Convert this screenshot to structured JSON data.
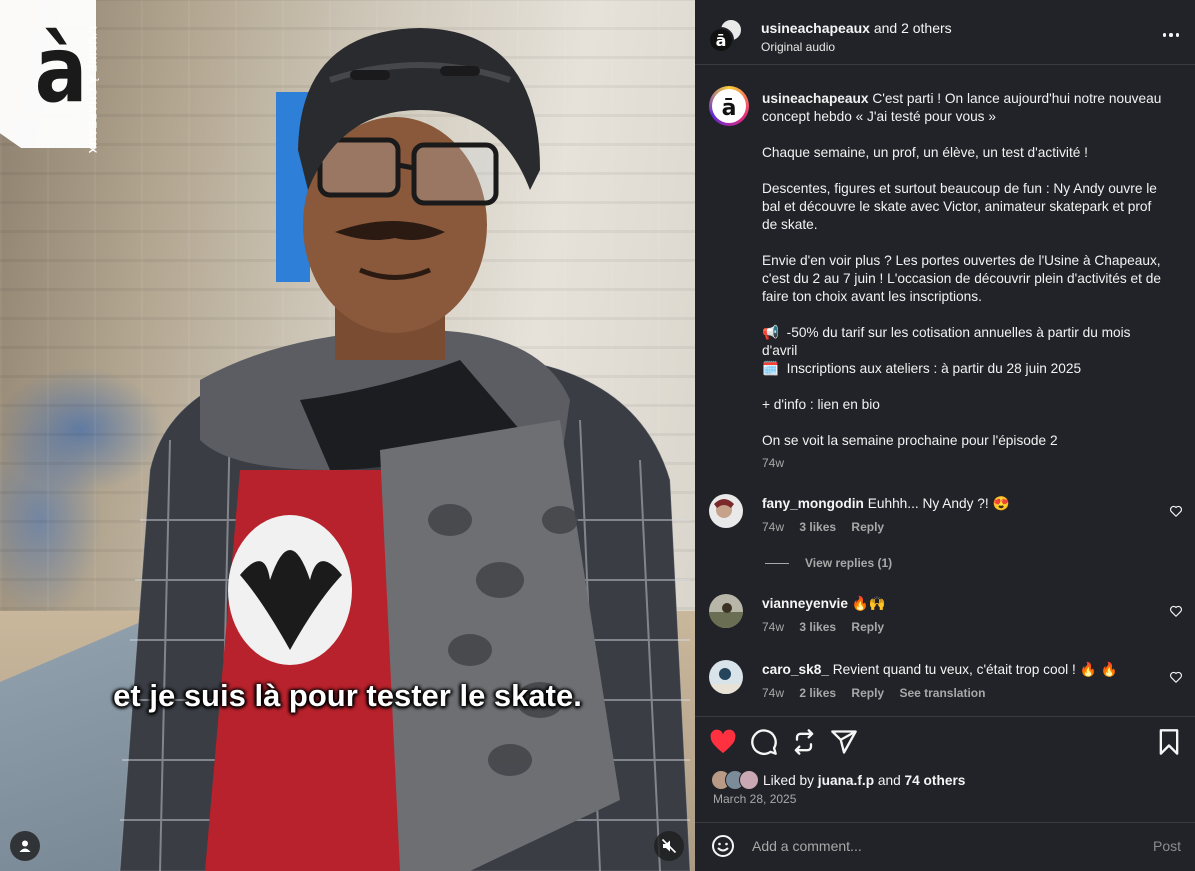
{
  "media": {
    "logo_glyph": "à",
    "logo_side_text": "L'USINE À CHAPEAUX",
    "subtitle": "et je suis là pour tester le skate."
  },
  "header": {
    "username": "usineachapeaux",
    "others": " and 2 others",
    "audio": "Original audio"
  },
  "caption": {
    "username": "usineachapeaux",
    "text": " C'est parti ! On lance aujourd'hui notre nouveau concept hebdo « J'ai testé pour vous »\n\nChaque semaine, un prof, un élève, un test d'activité !\n\nDescentes, figures et surtout beaucoup de fun : Ny Andy ouvre le bal et découvre le skate avec Victor, animateur skatepark et prof de skate.\n\nEnvie d'en voir plus ? Les portes ouvertes de l'Usine à Chapeaux, c'est du 2 au 7 juin ! L'occasion de découvrir plein d'activités et de faire ton choix avant les inscriptions.\n\n📢  -50% du tarif sur les cotisation annuelles à partir du mois d'avril\n🗓️  Inscriptions aux ateliers : à partir du 28 juin 2025\n\n+ d'info : lien en bio\n\nOn se voit la semaine prochaine pour l'épisode 2",
    "time": "74w"
  },
  "comments": [
    {
      "username": "fany_mongodin",
      "text": " Euhhh... Ny Andy ?! 😍",
      "time": "74w",
      "likes": "3 likes",
      "reply": "Reply",
      "translate": ""
    },
    {
      "username": "vianneyenvie",
      "text": " 🔥🙌",
      "time": "74w",
      "likes": "3 likes",
      "reply": "Reply",
      "translate": ""
    },
    {
      "username": "caro_sk8_",
      "text": " Revient quand tu veux, c'était trop cool ! 🔥 🔥",
      "time": "74w",
      "likes": "2 likes",
      "reply": "Reply",
      "translate": "See translation"
    }
  ],
  "view_replies": "View replies (1)",
  "likes": {
    "prefix": "Liked by ",
    "user": "juana.f.p",
    "middle": " and ",
    "others": "74 others"
  },
  "date": "March 28, 2025",
  "add_comment": {
    "placeholder": "Add a comment...",
    "post": "Post"
  },
  "colors": {
    "panel_bg": "#212328",
    "heart_red": "#ff3040",
    "muted_text": "#a8a8a8"
  }
}
